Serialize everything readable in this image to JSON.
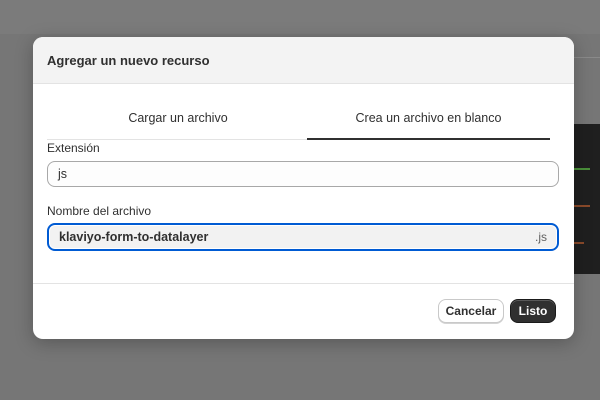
{
  "modal": {
    "title": "Agregar un nuevo recurso",
    "tabs": [
      {
        "label": "Cargar un archivo",
        "active": false
      },
      {
        "label": "Crea un archivo en blanco",
        "active": true
      }
    ],
    "extension": {
      "label": "Extensión",
      "value": "js"
    },
    "filename": {
      "label": "Nombre del archivo",
      "value": "klaviyo-form-to-datalayer",
      "suffix": ".js"
    },
    "buttons": {
      "cancel": "Cancelar",
      "done": "Listo"
    }
  },
  "colors": {
    "focus_border": "#005bd3",
    "primary_button": "#303030",
    "overlay": "#767676"
  }
}
